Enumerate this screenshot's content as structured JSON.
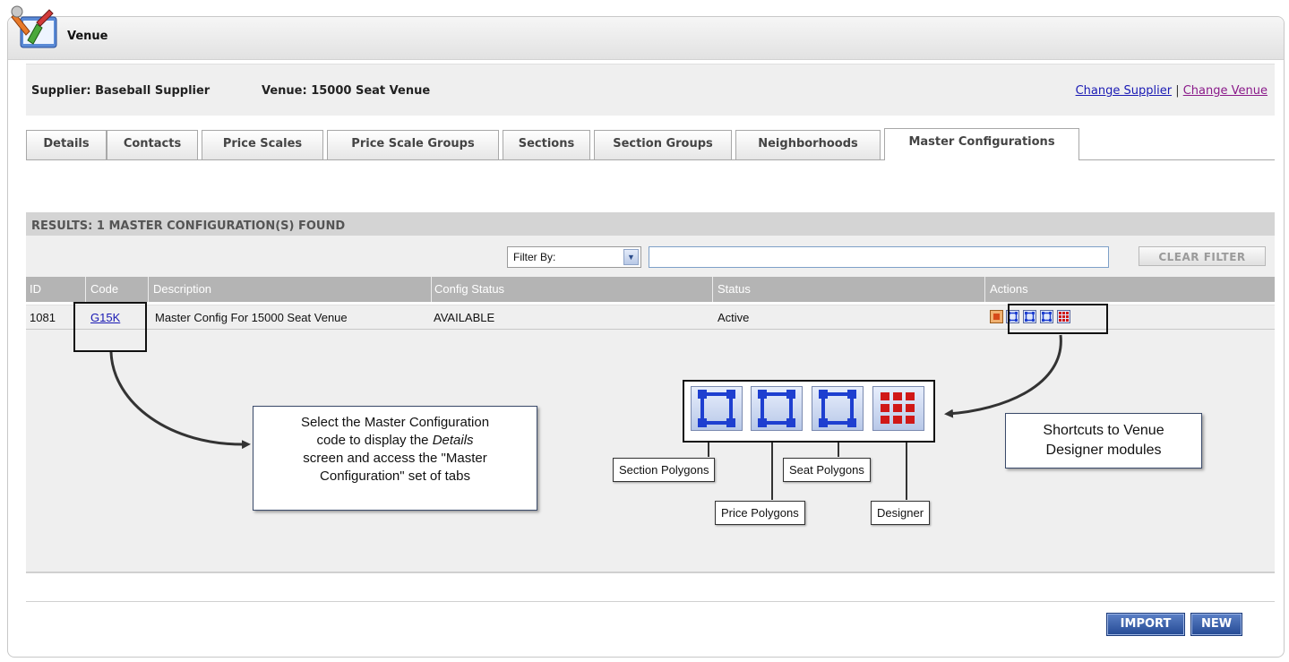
{
  "app": {
    "title": "Venue"
  },
  "info": {
    "supplier": "Supplier: Baseball Supplier",
    "venue": "Venue: 15000 Seat Venue",
    "change_supplier": "Change Supplier",
    "separator": "|",
    "change_venue": "Change Venue"
  },
  "tabs": [
    {
      "label": "Details"
    },
    {
      "label": "Contacts"
    },
    {
      "label": "Price Scales"
    },
    {
      "label": "Price Scale Groups"
    },
    {
      "label": "Sections"
    },
    {
      "label": "Section Groups"
    },
    {
      "label": "Neighborhoods"
    },
    {
      "label": "Master Configurations",
      "active": true
    }
  ],
  "results": {
    "heading": "RESULTS: 1 MASTER CONFIGURATION(S) FOUND"
  },
  "filter": {
    "select_value": "Filter By:",
    "input_value": "",
    "clear_label": "CLEAR FILTER"
  },
  "table": {
    "columns": [
      "ID",
      "Code",
      "Description",
      "Config Status",
      "Status",
      "Actions"
    ],
    "rows": [
      {
        "id": "1081",
        "code": "G15K",
        "description": "Master Config For 15000 Seat Venue",
        "config_status": "AVAILABLE",
        "status": "Active"
      }
    ]
  },
  "callouts": {
    "code": [
      "Select the Master Configuration",
      "code to display the ",
      "Details",
      "screen and access the \"Master",
      "Configuration\" set of tabs"
    ],
    "shortcuts": [
      "Shortcuts to Venue",
      "Designer modules"
    ]
  },
  "icon_labels": {
    "section": "Section Polygons",
    "price": "Price Polygons",
    "seat": "Seat Polygons",
    "designer": "Designer"
  },
  "buttons": {
    "import": "IMPORT",
    "new": "NEW"
  },
  "icons": [
    "venue-app-icon",
    "edit-icon",
    "section-polygon-icon",
    "price-polygon-icon",
    "seat-polygon-icon",
    "designer-icon"
  ],
  "colors": {
    "link": "#1a1ab4",
    "visited_link": "#8a1a8a",
    "button": "#2a4f9a",
    "designer": "#d01818",
    "polygon": "#1e3fd0"
  }
}
